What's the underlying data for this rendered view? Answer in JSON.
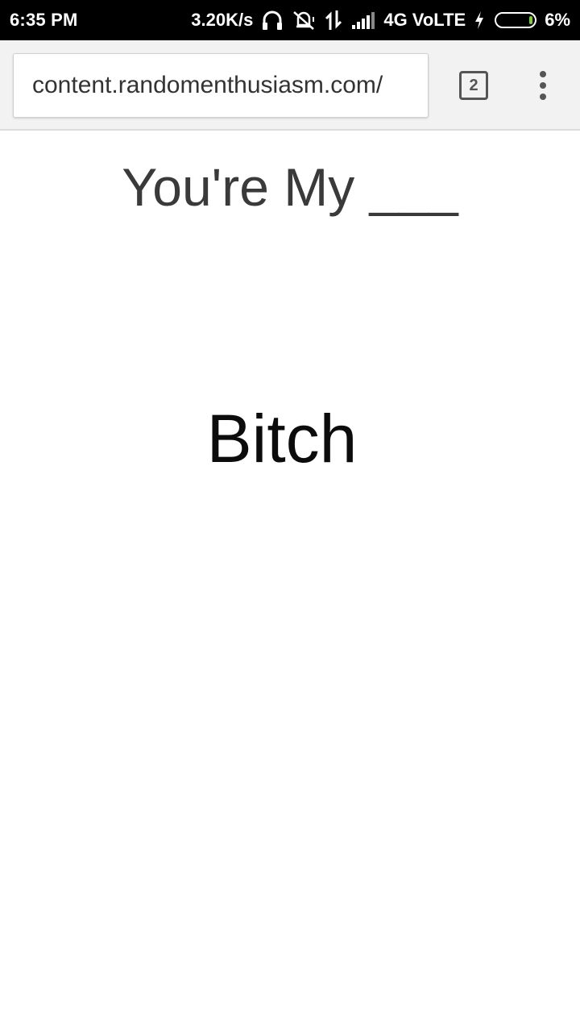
{
  "status_bar": {
    "time": "6:35 PM",
    "network_speed": "3.20K/s",
    "network_type": "4G VoLTE",
    "battery_percent": "6%",
    "battery_level": 0.06,
    "icons": [
      "headphones-icon",
      "vibrate-off-icon",
      "data-transfer-icon",
      "signal-bars-icon",
      "charging-bolt-icon",
      "battery-icon"
    ]
  },
  "browser": {
    "url": "content.randomenthusiasm.com/",
    "tab_count": "2",
    "menu_icon": "overflow-menu-icon"
  },
  "page": {
    "headline": "You're My ___",
    "answer": "Bitch"
  },
  "colors": {
    "status_bar_bg": "#000000",
    "toolbar_bg": "#f2f2f2",
    "page_bg": "#ffffff",
    "battery_fill": "#7bd13a"
  }
}
